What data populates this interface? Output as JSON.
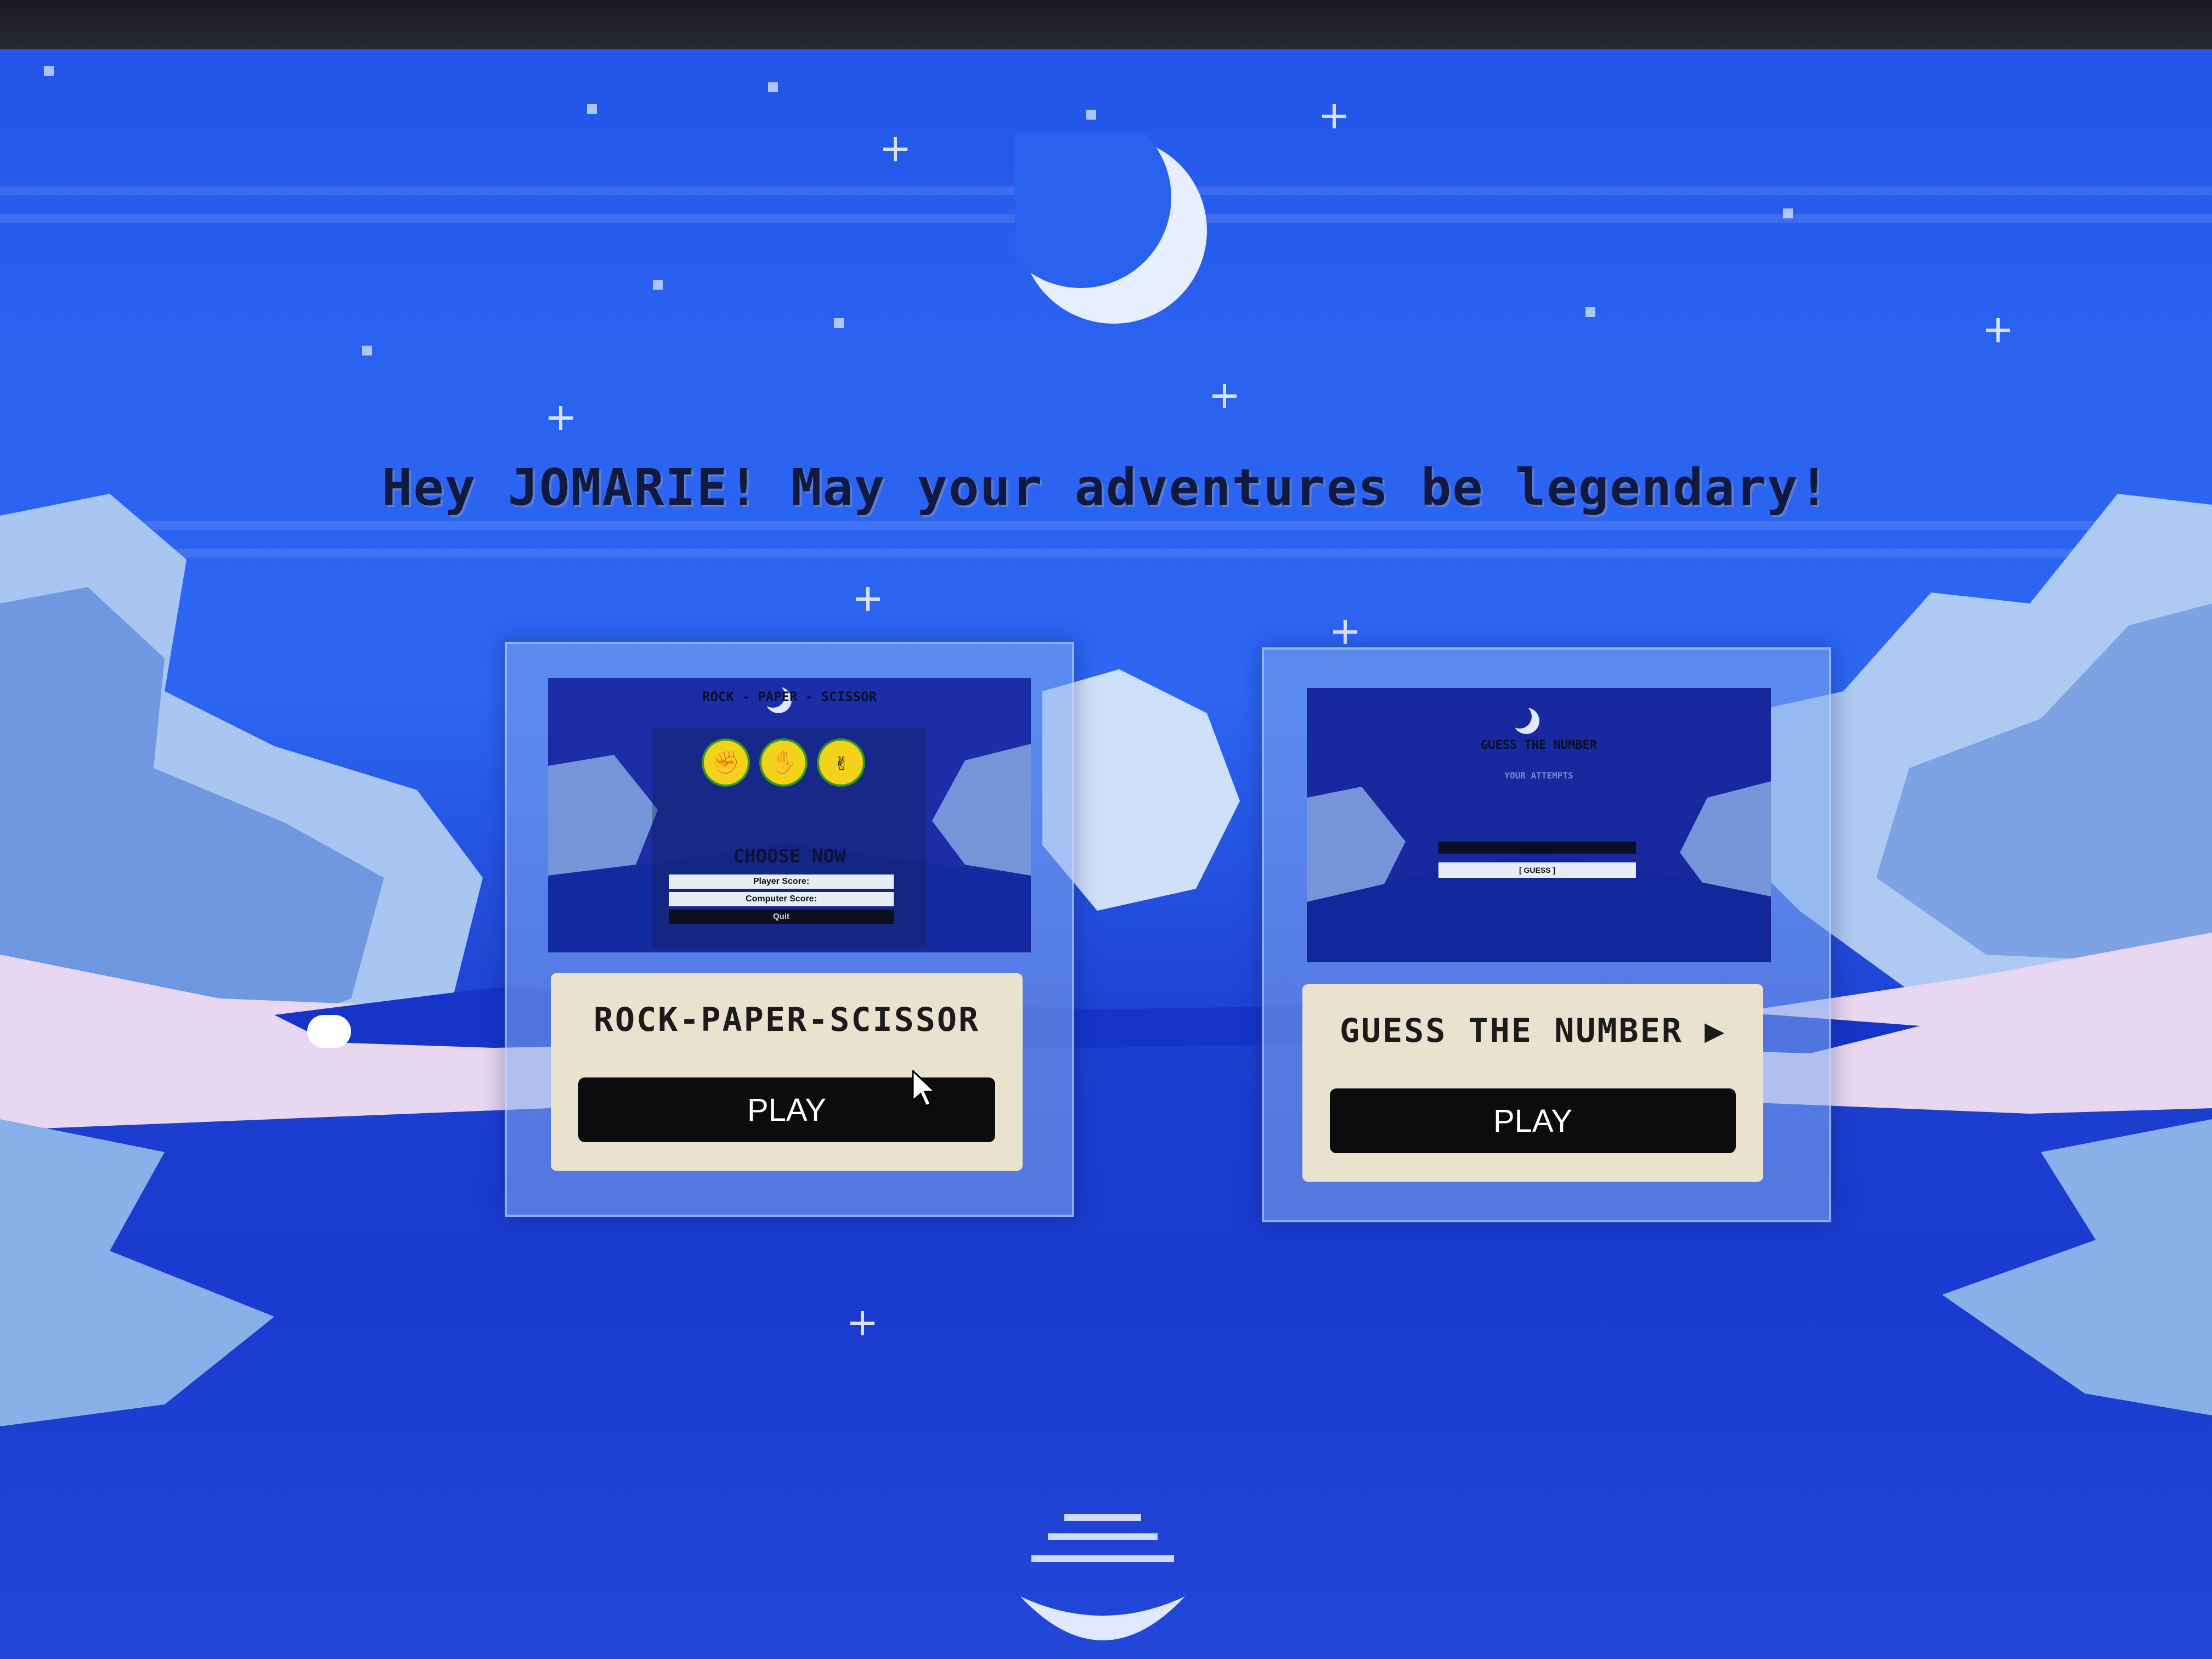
{
  "greeting": "Hey JOMARIE! May your adventures be legendary!",
  "colors": {
    "sky": "#2c66f2",
    "card_info_bg": "#e8e2cf",
    "button_bg": "#0c0c0e",
    "title_text": "#111a3e"
  },
  "games": [
    {
      "title": "ROCK-PAPER-SCISSOR",
      "play_label": "PLAY",
      "thumbnail": {
        "header": "ROCK - PAPER - SCISSOR",
        "hands": [
          "✊",
          "✋",
          "✌"
        ],
        "choose_text": "CHOOSE NOW",
        "player_score": "Player Score:",
        "computer_score": "Computer Score:",
        "quit": "Quit"
      }
    },
    {
      "title": "GUESS THE NUMBER ▶",
      "play_label": "PLAY",
      "thumbnail": {
        "header": "GUESS THE NUMBER",
        "attempts": "YOUR ATTEMPTS",
        "guess_label": "[ GUESS ]"
      }
    }
  ]
}
